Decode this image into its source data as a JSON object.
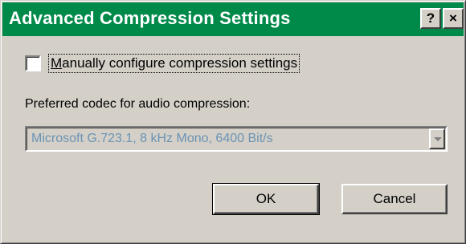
{
  "window": {
    "title": "Advanced Compression Settings",
    "help_glyph": "?",
    "close_glyph": "×"
  },
  "options": {
    "manual_config_mnemonic": "M",
    "manual_config_rest": "anually configure compression settings",
    "manual_config_checked": false
  },
  "codec": {
    "label": "Preferred codec for audio compression:",
    "selected": "Microsoft G.723.1, 8 kHz Mono, 6400 Bit/s",
    "enabled": false
  },
  "buttons": {
    "ok_label": "OK",
    "cancel_label": "Cancel"
  },
  "colors": {
    "titlebar": "#008a4a",
    "face": "#d4d0c8",
    "disabled_text": "#6a93b4"
  },
  "icons": {
    "help": "help-icon",
    "close": "close-icon",
    "dropdown": "chevron-down-icon"
  }
}
